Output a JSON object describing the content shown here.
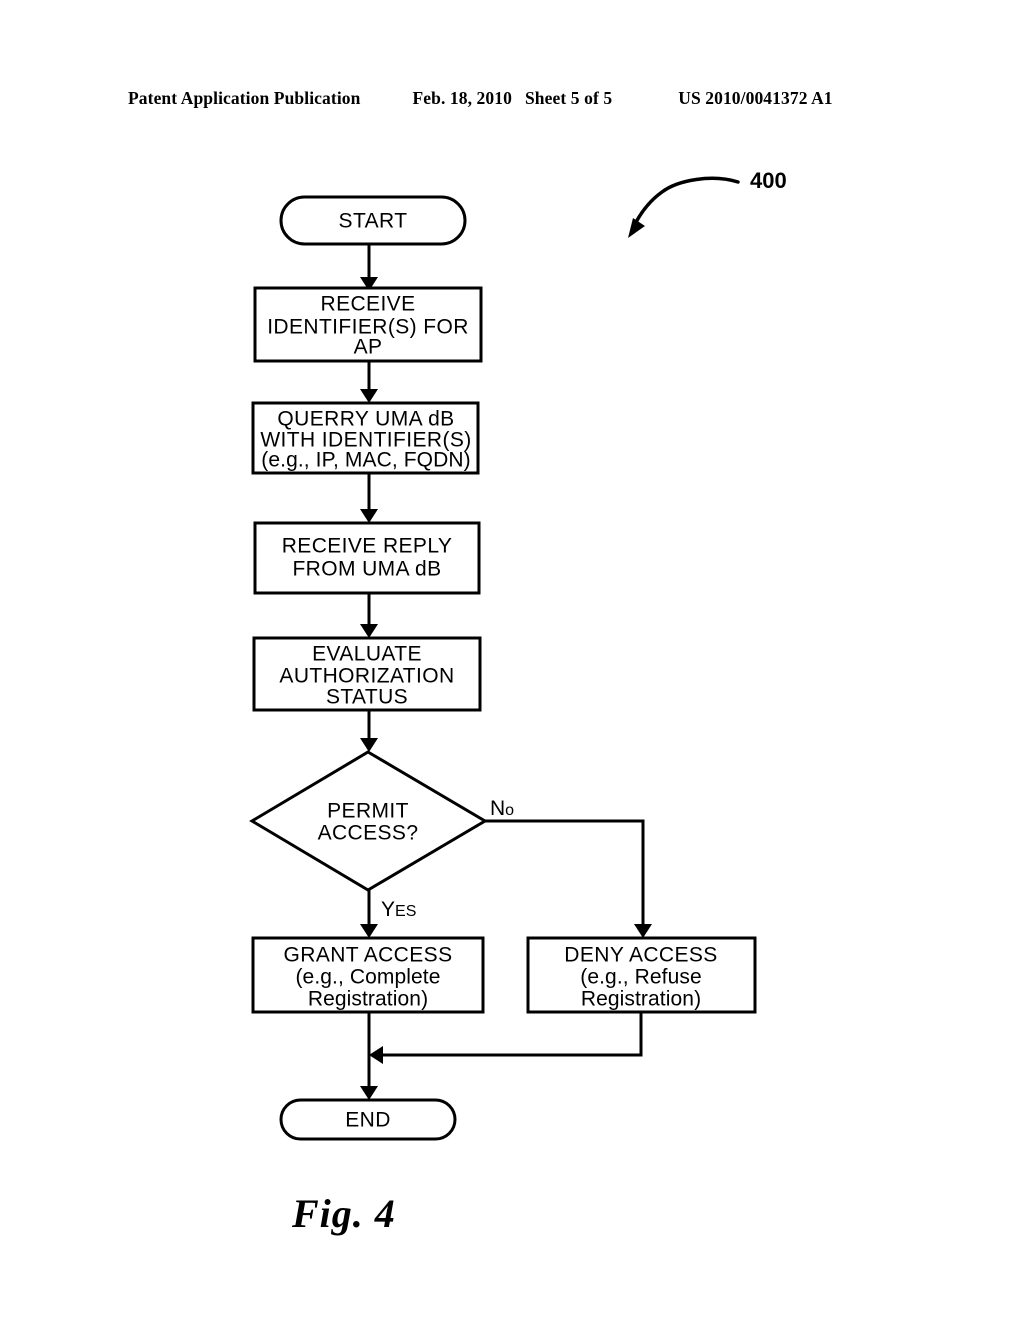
{
  "header": {
    "publication": "Patent Application Publication",
    "date": "Feb. 18, 2010",
    "sheet": "Sheet 5 of 5",
    "patent_number": "US 2010/0041372 A1"
  },
  "figure": {
    "caption": "Fig. 4",
    "reference_numeral": "400"
  },
  "flowchart": {
    "nodes": {
      "start": {
        "type": "terminator",
        "label": "START"
      },
      "receive_id": {
        "type": "process",
        "lines": [
          "RECEIVE",
          "IDENTIFIER(S) FOR",
          "AP"
        ]
      },
      "query_db": {
        "type": "process",
        "lines": [
          "QUERRY UMA dB",
          "WITH IDENTIFIER(S)",
          "(e.g., IP, MAC, FQDN)"
        ]
      },
      "receive_reply": {
        "type": "process",
        "lines": [
          "RECEIVE REPLY",
          "FROM UMA dB"
        ]
      },
      "evaluate": {
        "type": "process",
        "lines": [
          "EVALUATE",
          "AUTHORIZATION",
          "STATUS"
        ]
      },
      "decision": {
        "type": "decision",
        "lines": [
          "PERMIT",
          "ACCESS?"
        ]
      },
      "grant": {
        "type": "process",
        "lines": [
          "GRANT ACCESS",
          "(e.g., Complete",
          "Registration)"
        ]
      },
      "deny": {
        "type": "process",
        "lines": [
          "DENY ACCESS",
          "(e.g., Refuse",
          "Registration)"
        ]
      },
      "end": {
        "type": "terminator",
        "label": "END"
      }
    },
    "branch_labels": {
      "no": {
        "cap": "N",
        "rest": "o"
      },
      "yes": {
        "cap": "Y",
        "rest": "ES"
      }
    }
  }
}
